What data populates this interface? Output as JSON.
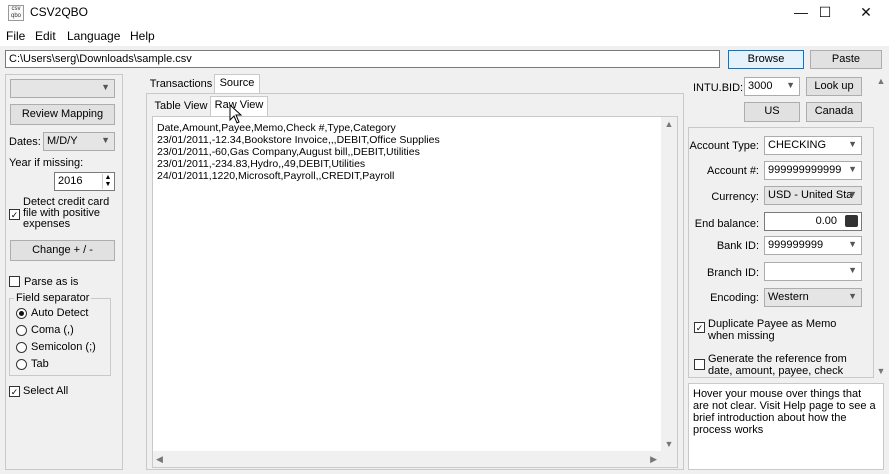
{
  "window": {
    "title": "CSV2QBO",
    "icon_text": "csv qbo",
    "controls": [
      "—",
      "☐",
      "✕"
    ]
  },
  "menu": [
    "File",
    "Edit",
    "Language",
    "Help"
  ],
  "file_path": "C:\\Users\\serg\\Downloads\\sample.csv",
  "buttons": {
    "browse": "Browse",
    "paste": "Paste",
    "review_mapping": "Review Mapping",
    "change": "Change + / -",
    "lookup": "Look up",
    "us": "US",
    "canada": "Canada"
  },
  "left": {
    "dates_label": "Dates:",
    "dates_value": "M/D/Y",
    "year_label": "Year if missing:",
    "year_value": "2016",
    "detect_cc_label": "Detect credit card file with positive expenses",
    "detect_cc_checked": true,
    "parse_as_is": "Parse as is",
    "field_separator_title": "Field separator",
    "separators": [
      "Auto Detect",
      "Coma (,)",
      "Semicolon (;)",
      "Tab"
    ],
    "separator_selected": "Auto Detect",
    "select_all": "Select All"
  },
  "tabs": {
    "main": [
      "Transactions",
      "Source"
    ],
    "main_active": "Source",
    "sub": [
      "Table View",
      "Raw View"
    ],
    "sub_active": "Raw View"
  },
  "raw_lines": [
    "Date,Amount,Payee,Memo,Check #,Type,Category",
    "23/01/2011,-12.34,Bookstore Invoice,,,DEBIT,Office Supplies",
    "23/01/2011,-60,Gas Company,August bill,,DEBIT,Utilities",
    "23/01/2011,-234.83,Hydro,,49,DEBIT,Utilities",
    "24/01/2011,1220,Microsoft,Payroll,,CREDIT,Payroll"
  ],
  "right": {
    "intu_bid_label": "INTU.BID:",
    "intu_bid_value": "3000",
    "account_type_label": "Account Type:",
    "account_type_value": "CHECKING",
    "account_num_label": "Account #:",
    "account_num_value": "999999999999",
    "currency_label": "Currency:",
    "currency_value": "USD - United Sta",
    "end_balance_label": "End balance:",
    "end_balance_value": "0.00",
    "bank_id_label": "Bank ID:",
    "bank_id_value": "999999999",
    "branch_id_label": "Branch ID:",
    "branch_id_value": "",
    "encoding_label": "Encoding:",
    "encoding_value": "Western",
    "dup_payee_label": "Duplicate Payee as Memo when missing",
    "dup_payee_checked": true,
    "gen_ref_label": "Generate the reference from date, amount, payee, check",
    "gen_ref_checked": false,
    "help_text": "Hover your mouse over things that are not clear. Visit Help page to see a brief introduction about how the process works"
  }
}
